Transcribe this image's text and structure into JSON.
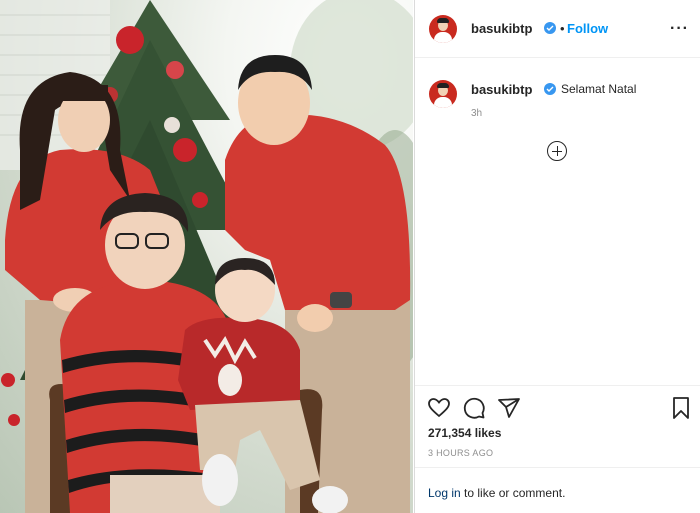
{
  "post": {
    "username": "basukibtp",
    "follow_label": "Follow",
    "separator": "•",
    "more_label": "···",
    "caption": "Selamat Natal",
    "caption_age": "3h",
    "likes": "271,354 likes",
    "timestamp": "3 HOURS AGO",
    "login_link": "Log in",
    "login_rest": " to like or comment."
  },
  "photo": {
    "watermark": "",
    "colors": {
      "sweater_red": "#d23a33",
      "stripe_black": "#1c1c1c",
      "khaki": "#c9b299",
      "tree_green": "#3d5a3a"
    }
  },
  "colors": {
    "accent_blue": "#0095f6",
    "verified_blue": "#3897f0",
    "text": "#262626",
    "muted": "#8e8e8e"
  },
  "icons": [
    "heart-icon",
    "comment-icon",
    "share-icon",
    "bookmark-icon",
    "add-comment-icon",
    "more-icon",
    "verified-icon"
  ]
}
